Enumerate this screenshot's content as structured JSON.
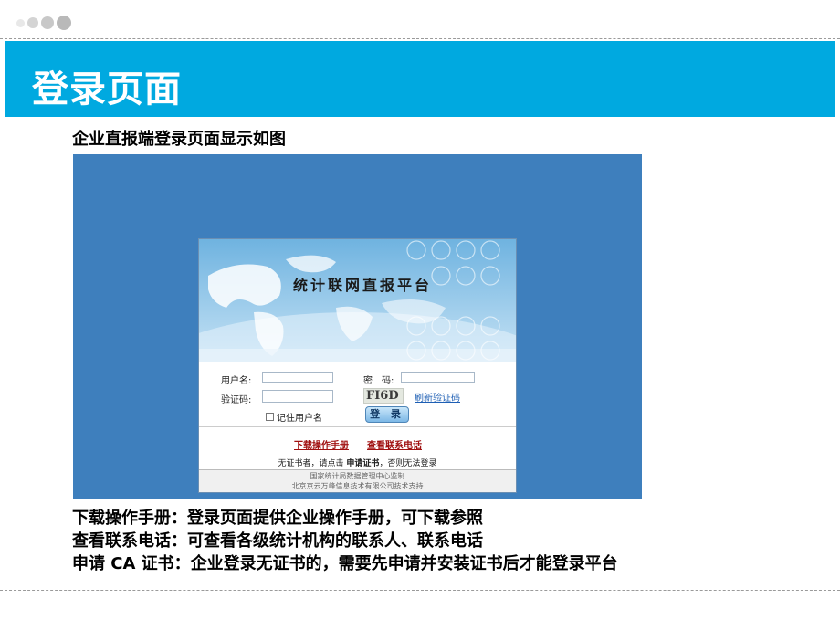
{
  "header": {
    "title": "登录页面",
    "accent": "#00a9e0",
    "dot_colors": [
      "#e8e8e8",
      "#d4d4d4",
      "#c8c8c8",
      "#b9b9b9"
    ]
  },
  "caption": "企业直报端登录页面显示如图",
  "login_panel": {
    "background": "#3e7fbd",
    "platform_title": "统计联网直报平台",
    "username_label": "用户名:",
    "password_label": "密　码:",
    "captcha_label": "验证码:",
    "captcha_code": "FI6D",
    "refresh_link": "刷新验证码",
    "remember_label": "记住用户名",
    "login_button": "登 录",
    "download_manual_link": "下载操作手册",
    "contact_link": "查看联系电话",
    "cert_prefix": "无证书者，请点击",
    "cert_link": "申请证书",
    "cert_suffix": "，否则无法登录",
    "footer_line1": "国家统计局数据管理中心监制",
    "footer_line2": "北京京云万峰信息技术有限公司技术支持"
  },
  "descriptions": [
    "下载操作手册：登录页面提供企业操作手册，可下载参照",
    "查看联系电话：可查看各级统计机构的联系人、联系电话",
    "申请 CA 证书：企业登录无证书的，需要先申请并安装证书后才能登录平台"
  ]
}
